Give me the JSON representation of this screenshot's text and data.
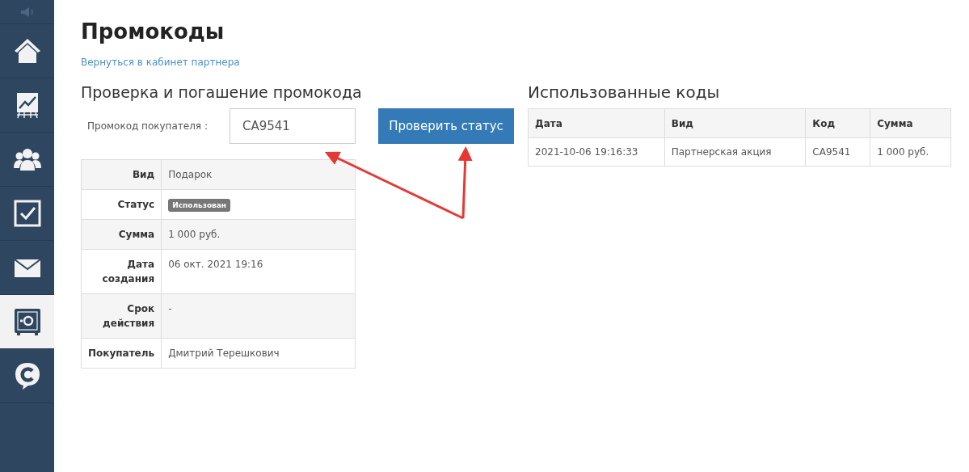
{
  "sidebar": {
    "items": [
      {
        "kind": "home",
        "selected": false
      },
      {
        "kind": "chart",
        "selected": false
      },
      {
        "kind": "people",
        "selected": false
      },
      {
        "kind": "check",
        "selected": false
      },
      {
        "kind": "mail",
        "selected": false
      },
      {
        "kind": "safe",
        "selected": true
      },
      {
        "kind": "chat",
        "selected": false
      }
    ]
  },
  "page": {
    "title": "Промокоды",
    "back_link": "Вернуться в кабинет партнера"
  },
  "check_section": {
    "heading": "Проверка и погашение промокода",
    "field_label": "Промокод покупателя :",
    "field_value": "CA9541",
    "button": "Проверить статус",
    "details": [
      {
        "label": "Вид",
        "value": "Подарок",
        "kind": "text"
      },
      {
        "label": "Статус",
        "value": "Использован",
        "kind": "badge"
      },
      {
        "label": "Сумма",
        "value": "1 000 руб.",
        "kind": "text"
      },
      {
        "label": "Дата создания",
        "value": "06 окт. 2021 19:16",
        "kind": "text"
      },
      {
        "label": "Срок действия",
        "value": "-",
        "kind": "text"
      },
      {
        "label": "Покупатель",
        "value": "Дмитрий Терешкович",
        "kind": "text"
      }
    ]
  },
  "used_section": {
    "heading": "Использованные коды",
    "columns": [
      "Дата",
      "Вид",
      "Код",
      "Сумма"
    ],
    "rows": [
      [
        "2021-10-06 19:16:33",
        "Партнерская акция",
        "CA9541",
        "1 000 руб."
      ]
    ]
  }
}
